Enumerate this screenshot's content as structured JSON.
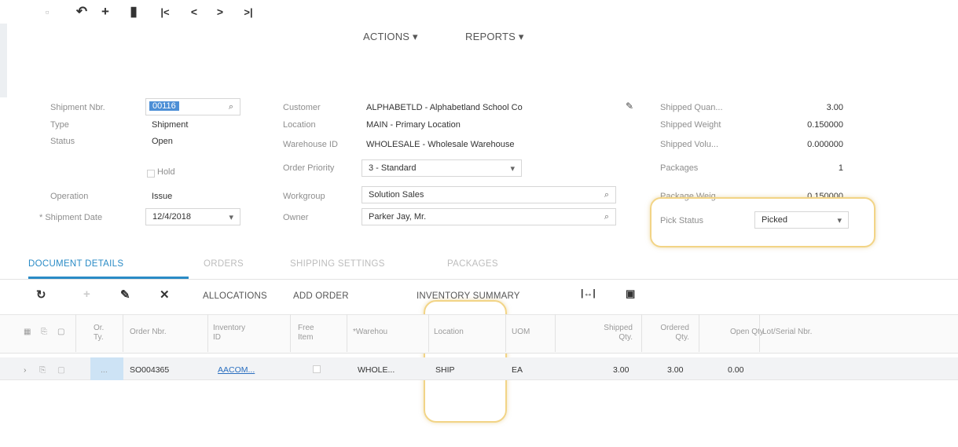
{
  "toolbar": {
    "actions_label": "ACTIONS ▾",
    "reports_label": "REPORTS ▾",
    "icons": [
      "save-icon",
      "undo-icon",
      "add-icon",
      "delete-icon",
      "first-icon",
      "prev-icon",
      "next-icon",
      "last-icon"
    ]
  },
  "summary": {
    "shipment_nbr_label": "Shipment Nbr.",
    "shipment_nbr": "00116",
    "type_label": "Type",
    "type": "Shipment",
    "status_label": "Status",
    "status": "Open",
    "hold_label": "Hold",
    "operation_label": "Operation",
    "operation": "Issue",
    "shipment_date_label": "* Shipment Date",
    "shipment_date": "12/4/2018",
    "customer_label": "Customer",
    "customer": "ALPHABETLD - Alphabetland School Co",
    "location_label": "Location",
    "location": "MAIN - Primary Location",
    "warehouse_label": "Warehouse ID",
    "warehouse": "WHOLESALE - Wholesale Warehouse",
    "order_priority_label": "Order Priority",
    "order_priority": "3 - Standard",
    "workgroup_label": "Workgroup",
    "workgroup": "Solution Sales",
    "owner_label": "Owner",
    "owner": "Parker Jay, Mr.",
    "shipped_qty_label": "Shipped Quan...",
    "shipped_qty": "3.00",
    "shipped_weight_label": "Shipped Weight",
    "shipped_weight": "0.150000",
    "shipped_volume_label": "Shipped Volu...",
    "shipped_volume": "0.000000",
    "packages_label": "Packages",
    "packages": "1",
    "package_weight_label": "Package Weig...",
    "package_weight": "0.150000",
    "pick_status_label": "Pick Status",
    "pick_status": "Picked"
  },
  "tabs": [
    "DOCUMENT DETAILS",
    "ORDERS",
    "SHIPPING SETTINGS",
    "PACKAGES"
  ],
  "grid_toolbar": {
    "allocations": "ALLOCATIONS",
    "add_order": "ADD ORDER",
    "inventory_summary": "INVENTORY SUMMARY"
  },
  "grid": {
    "headers": {
      "or_ty": "Or.\nTy.",
      "order_nbr": "Order Nbr.",
      "inventory_id": "Inventory\nID",
      "free_item": "Free\nItem",
      "warehouse": "*Warehou",
      "location": "Location",
      "uom": "UOM",
      "shipped_qty": "Shipped\nQty.",
      "ordered_qty": "Ordered\nQty.",
      "open_qty": "Open Qty.",
      "lot_serial": "Lot/Serial Nbr."
    },
    "rows": [
      {
        "or_ty": "...",
        "order_nbr": "SO004365",
        "inventory_id": "AACOM...",
        "warehouse": "WHOLE...",
        "location": "SHIP",
        "uom": "EA",
        "shipped_qty": "3.00",
        "ordered_qty": "3.00",
        "open_qty": "0.00"
      }
    ]
  },
  "colors": {
    "accent": "#2a8bc6",
    "highlight": "#f2d486"
  }
}
